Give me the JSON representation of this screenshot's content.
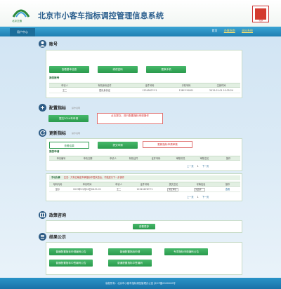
{
  "header": {
    "logo_text": "北京交通",
    "site_title": "北京市小客车指标调控管理信息系统",
    "emblem_text": "北京"
  },
  "navbar": {
    "active_tab": "用户中心",
    "links": [
      "首页",
      "办事指南",
      "退出系统"
    ]
  },
  "account": {
    "title": "账号",
    "buttons": [
      "查看基本信息",
      "修改密码",
      "更换手机"
    ],
    "sub_title": "我的账号",
    "columns": [
      "申请人",
      "有效身份证件",
      "证件号码",
      "手机号码",
      "注册时间"
    ],
    "row": [
      "王二",
      "居民身份证",
      "1234567***1",
      "138****0001",
      "2013-01-01 10:35:24"
    ]
  },
  "config": {
    "title": "配置指标",
    "subtitle": "操作说明",
    "button": "提交2014年申请",
    "callout": "点击提交，进行配置指标申请操作"
  },
  "update": {
    "title": "更新指标",
    "subtitle": "操作说明",
    "buttons": [
      "查看结果",
      "提交申请"
    ],
    "callout": "更新指标申请审核",
    "sub_title": "我的申请",
    "columns": [
      "申请编号",
      "申请日期",
      "申请人",
      "有效证件",
      "证件号码",
      "审核情况",
      "审核意见",
      "操作"
    ],
    "pager": [
      "上一页",
      "1",
      "下一页"
    ]
  },
  "tasks": {
    "title": "手动办事",
    "notice": "注意：只有已确定车辆指标中签状态后，才能进行下一步操作",
    "columns": [
      "号码代码",
      "申请时间",
      "申请人",
      "证件号码",
      "提交意见",
      "号牌信息",
      "操作"
    ],
    "row": [
      "显示",
      "2013年12月26日08:31:21",
      "王二",
      "12345678***1",
      "通过审核",
      "某品牌",
      "查看"
    ],
    "pager": [
      "上一页",
      "1",
      "下一页"
    ]
  },
  "policy": {
    "title": "政策咨询",
    "button": "查看更多"
  },
  "results": {
    "title": "结果公示",
    "buttons": [
      "普通配置指标申请编码公告",
      "普通配置指标申请",
      "专项指标申请编码公告",
      "普通配置指标中签编码公告",
      "普通配置指标中签编码"
    ]
  },
  "footer": {
    "text": "版权所有：北京市小客车指标调控管理办公室  京ICP备0000000号"
  }
}
